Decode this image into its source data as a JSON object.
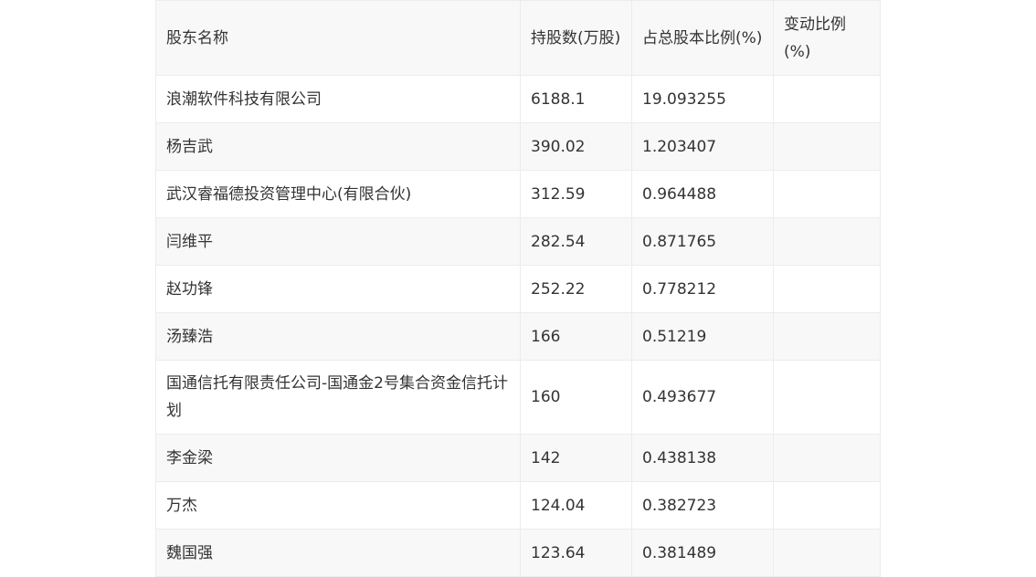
{
  "table": {
    "headers": [
      "股东名称",
      "持股数(万股)",
      "占总股本比例(%)",
      "变动比例(%)"
    ],
    "rows": [
      {
        "name": "浪潮软件科技有限公司",
        "shares": "6188.1",
        "ratio": "19.093255",
        "change": ""
      },
      {
        "name": "杨吉武",
        "shares": "390.02",
        "ratio": "1.203407",
        "change": ""
      },
      {
        "name": "武汉睿福德投资管理中心(有限合伙)",
        "shares": "312.59",
        "ratio": "0.964488",
        "change": ""
      },
      {
        "name": "闫维平",
        "shares": "282.54",
        "ratio": "0.871765",
        "change": ""
      },
      {
        "name": "赵功锋",
        "shares": "252.22",
        "ratio": "0.778212",
        "change": ""
      },
      {
        "name": "汤臻浩",
        "shares": "166",
        "ratio": "0.51219",
        "change": ""
      },
      {
        "name": "国通信托有限责任公司-国通金2号集合资金信托计划",
        "shares": "160",
        "ratio": "0.493677",
        "change": ""
      },
      {
        "name": "李金梁",
        "shares": "142",
        "ratio": "0.438138",
        "change": ""
      },
      {
        "name": "万杰",
        "shares": "124.04",
        "ratio": "0.382723",
        "change": ""
      },
      {
        "name": "魏国强",
        "shares": "123.64",
        "ratio": "0.381489",
        "change": ""
      }
    ]
  }
}
